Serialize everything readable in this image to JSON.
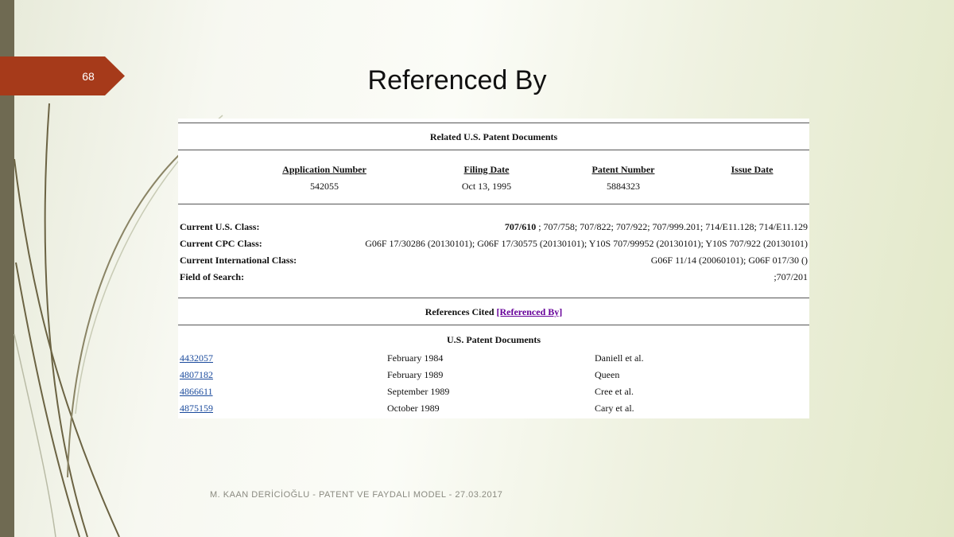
{
  "slide": {
    "number": "68",
    "title": "Referenced By",
    "footer": "M. KAAN DERİCİOĞLU - PATENT VE FAYDALI MODEL - 27.03.2017"
  },
  "colors": {
    "tab": "#a63a1a",
    "left_bar": "#6f6a52",
    "link": "#1a4a9c",
    "visited_link": "#660099"
  },
  "related": {
    "heading": "Related U.S. Patent Documents",
    "columns": [
      "Application Number",
      "Filing Date",
      "Patent Number",
      "Issue Date"
    ],
    "values": [
      "542055",
      "Oct 13, 1995",
      "5884323",
      ""
    ]
  },
  "classes": [
    {
      "label": "Current U.S. Class:",
      "bold_value": "707/610",
      "value": " ; 707/758; 707/822; 707/922; 707/999.201; 714/E11.128; 714/E11.129"
    },
    {
      "label": "Current CPC Class:",
      "bold_value": "",
      "value": "G06F 17/30286 (20130101); G06F 17/30575 (20130101); Y10S 707/99952 (20130101); Y10S 707/922 (20130101)"
    },
    {
      "label": "Current International Class:",
      "bold_value": "",
      "value": "G06F 11/14 (20060101); G06F 017/30 ()"
    },
    {
      "label": "Field of Search:",
      "bold_value": "",
      "value": ";707/201"
    }
  ],
  "references": {
    "heading_text": "References Cited ",
    "heading_link": "[Referenced By]",
    "subheading": "U.S. Patent Documents",
    "rows": [
      {
        "patent": "4432057",
        "date": "February 1984",
        "inventor": "Daniell et al."
      },
      {
        "patent": "4807182",
        "date": "February 1989",
        "inventor": "Queen"
      },
      {
        "patent": "4866611",
        "date": "September 1989",
        "inventor": "Cree et al."
      },
      {
        "patent": "4875159",
        "date": "October 1989",
        "inventor": "Cary et al."
      }
    ]
  }
}
